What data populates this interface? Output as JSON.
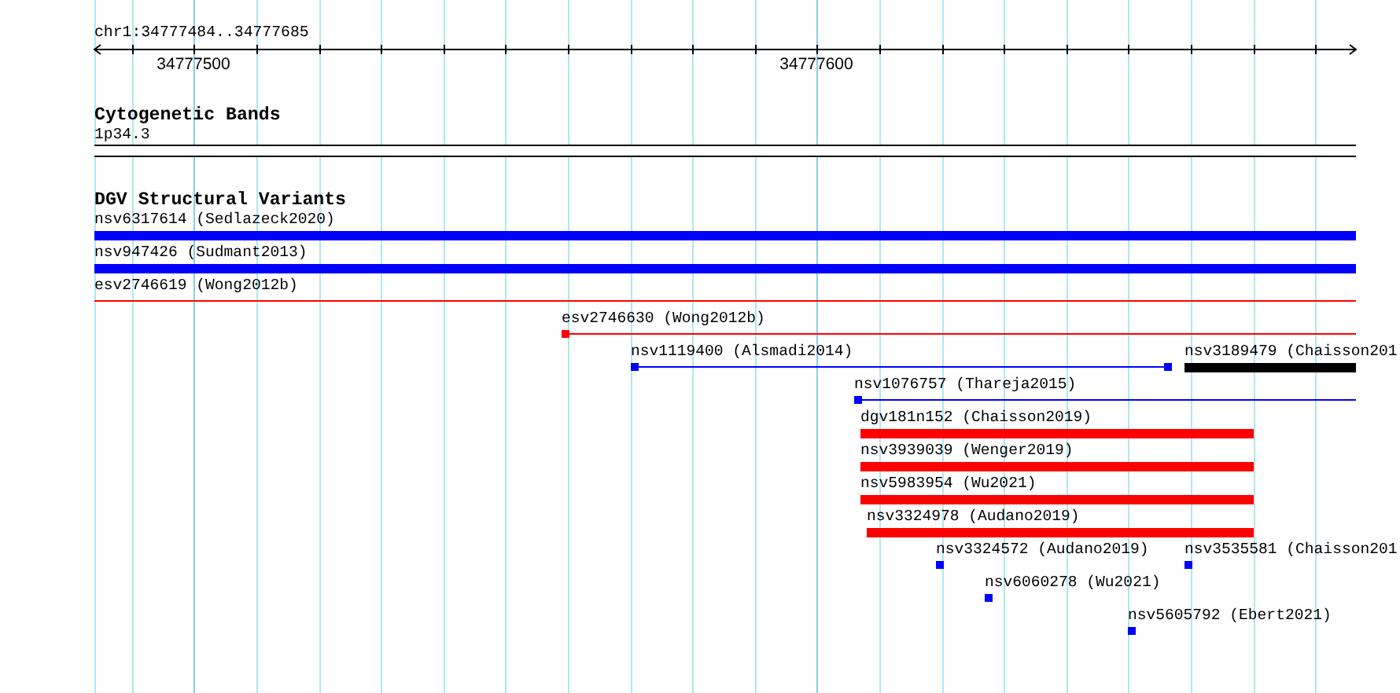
{
  "ruler": {
    "label": "chr1:34777484..34777685",
    "tick_labels": [
      "34777500",
      "34777600"
    ]
  },
  "tracks": [
    {
      "title": "Cytogenetic Bands",
      "rows": [
        {
          "features": [
            {
              "label": "1p34.3",
              "kind": "band"
            }
          ]
        }
      ]
    },
    {
      "title": "DGV Structural Variants",
      "rows": [
        {
          "features": [
            {
              "label": "nsv6317614 (Sedlazeck2020)",
              "kind": "bar",
              "color": "#0000ff"
            }
          ]
        },
        {
          "features": [
            {
              "label": "nsv947426 (Sudmant2013)",
              "kind": "bar",
              "color": "#0000ff"
            }
          ]
        },
        {
          "features": [
            {
              "label": "esv2746619 (Wong2012b)",
              "kind": "line",
              "color": "#ff0000"
            }
          ]
        },
        {
          "features": [
            {
              "label": "esv2746630 (Wong2012b)",
              "kind": "line",
              "color": "#ff0000"
            }
          ]
        },
        {
          "features": [
            {
              "label": "nsv1119400 (Alsmadi2014)",
              "kind": "paired",
              "color": "#0000ff"
            },
            {
              "label": "nsv3189479 (Chaisson201",
              "kind": "bar",
              "color": "#000000"
            }
          ]
        },
        {
          "features": [
            {
              "label": "nsv1076757 (Thareja2015)",
              "kind": "line",
              "color": "#0000ff"
            }
          ]
        },
        {
          "features": [
            {
              "label": "dgv181n152 (Chaisson2019)",
              "kind": "bar",
              "color": "#ff0000"
            }
          ]
        },
        {
          "features": [
            {
              "label": "nsv3939039 (Wenger2019)",
              "kind": "bar",
              "color": "#ff0000"
            }
          ]
        },
        {
          "features": [
            {
              "label": "nsv5983954 (Wu2021)",
              "kind": "bar",
              "color": "#ff0000"
            }
          ]
        },
        {
          "features": [
            {
              "label": "nsv3324978 (Audano2019)",
              "kind": "bar",
              "color": "#ff0000"
            }
          ]
        },
        {
          "features": [
            {
              "label": "nsv3324572 (Audano2019)",
              "kind": "point",
              "color": "#0000ff"
            },
            {
              "label": "nsv3535581 (Chaisson201",
              "kind": "point",
              "color": "#0000ff"
            }
          ]
        },
        {
          "features": [
            {
              "label": "nsv6060278 (Wu2021)",
              "kind": "point",
              "color": "#0000ff"
            }
          ]
        },
        {
          "features": [
            {
              "label": "nsv5605792 (Ebert2021)",
              "kind": "point",
              "color": "#0000ff"
            }
          ]
        }
      ]
    }
  ]
}
